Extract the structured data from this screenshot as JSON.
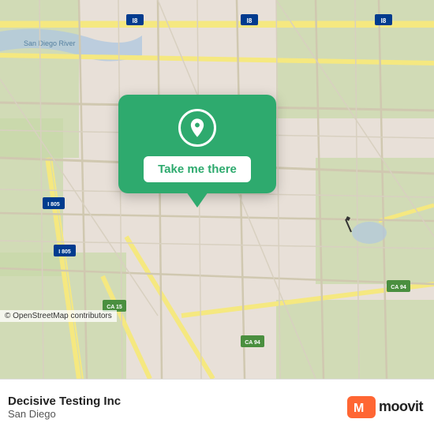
{
  "map": {
    "background_color": "#e8e0d8",
    "attribution": "© OpenStreetMap contributors"
  },
  "popup": {
    "button_label": "Take me there",
    "bg_color": "#2eaa6e"
  },
  "bottom_bar": {
    "title": "Decisive Testing Inc",
    "subtitle": "San Diego"
  },
  "moovit": {
    "text": "moovit",
    "icon_color": "#ff6633"
  }
}
